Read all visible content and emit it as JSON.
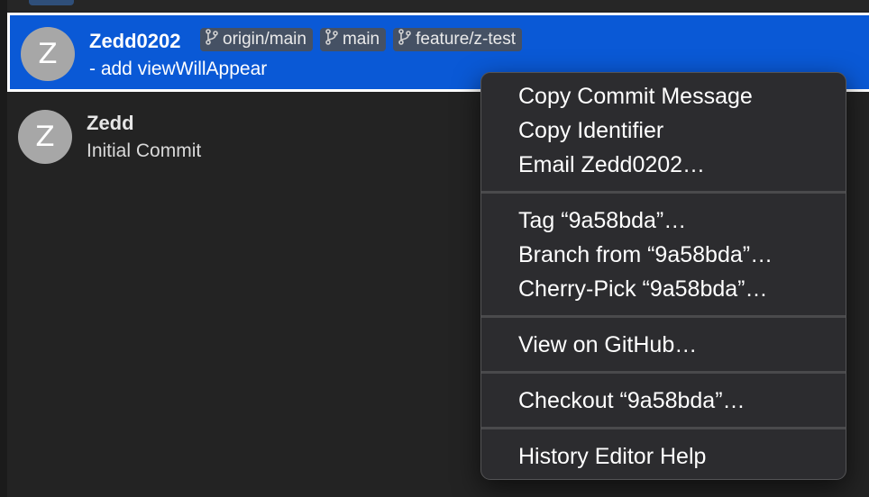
{
  "commits": [
    {
      "avatar_initial": "Z",
      "author": "Zedd0202",
      "message": "- add viewWillAppear",
      "refs": [
        "origin/main",
        "main",
        "feature/z-test"
      ],
      "selected": true
    },
    {
      "avatar_initial": "Z",
      "author": "Zedd",
      "message": "Initial Commit",
      "refs": [],
      "selected": false
    }
  ],
  "context_menu": {
    "copy_commit_message": "Copy Commit Message",
    "copy_identifier": "Copy Identifier",
    "email_author": "Email Zedd0202…",
    "tag": "Tag “9a58bda”…",
    "branch_from": "Branch from “9a58bda”…",
    "cherry_pick": "Cherry-Pick “9a58bda”…",
    "view_on_github": "View on GitHub…",
    "checkout": "Checkout “9a58bda”…",
    "history_editor_help": "History Editor Help"
  },
  "icons": {
    "branch": "branch-icon"
  },
  "colors": {
    "selection": "#0a59d6",
    "background": "#232323",
    "menu_background": "#2c2c2f"
  }
}
